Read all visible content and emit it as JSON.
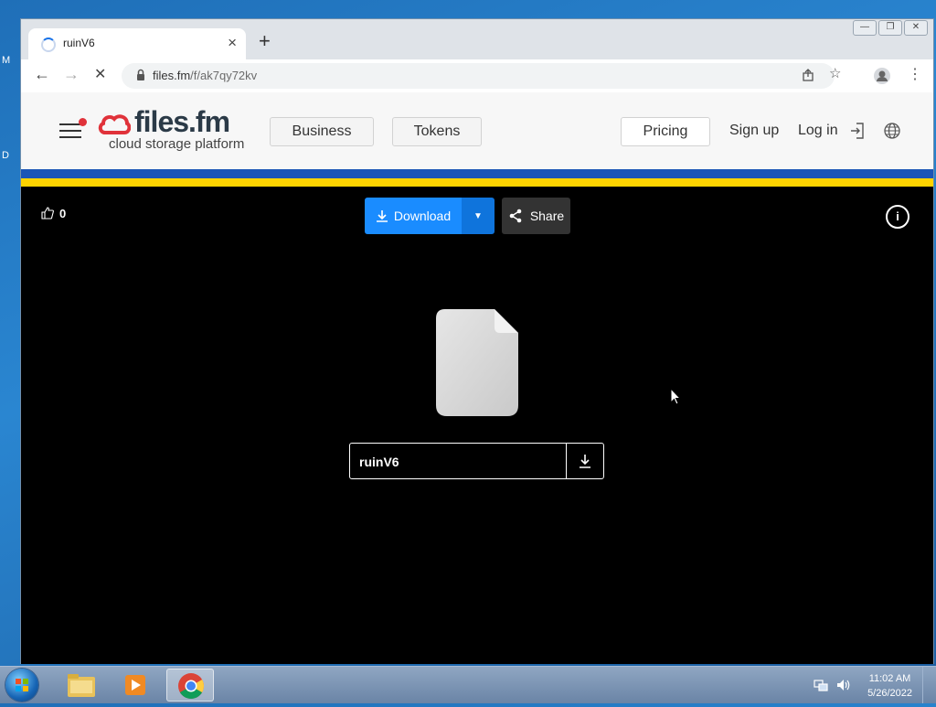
{
  "desktop": {
    "left_letters": [
      "M",
      "D"
    ]
  },
  "browser": {
    "tab": {
      "title": "ruinV6",
      "close": "×"
    },
    "new_tab": "+",
    "nav": {
      "back": "←",
      "forward": "→",
      "reload": "✕"
    },
    "url": {
      "host": "files.fm",
      "path": "/f/ak7qy72kv"
    }
  },
  "site": {
    "logo": {
      "name": "files.fm",
      "tagline": "cloud storage platform"
    },
    "nav": {
      "business": "Business",
      "tokens": "Tokens",
      "pricing": "Pricing",
      "signup": "Sign up",
      "login": "Log in"
    }
  },
  "viewer": {
    "likes": "0",
    "download_label": "Download",
    "share_label": "Share",
    "info": "i",
    "file_name": "ruinV6"
  },
  "taskbar": {
    "time": "11:02 AM",
    "date": "5/26/2022"
  },
  "colors": {
    "download_blue": "#1a8cff",
    "flag_blue": "#1b55b6",
    "flag_yellow": "#ffd400",
    "logo_red": "#e0323a"
  }
}
